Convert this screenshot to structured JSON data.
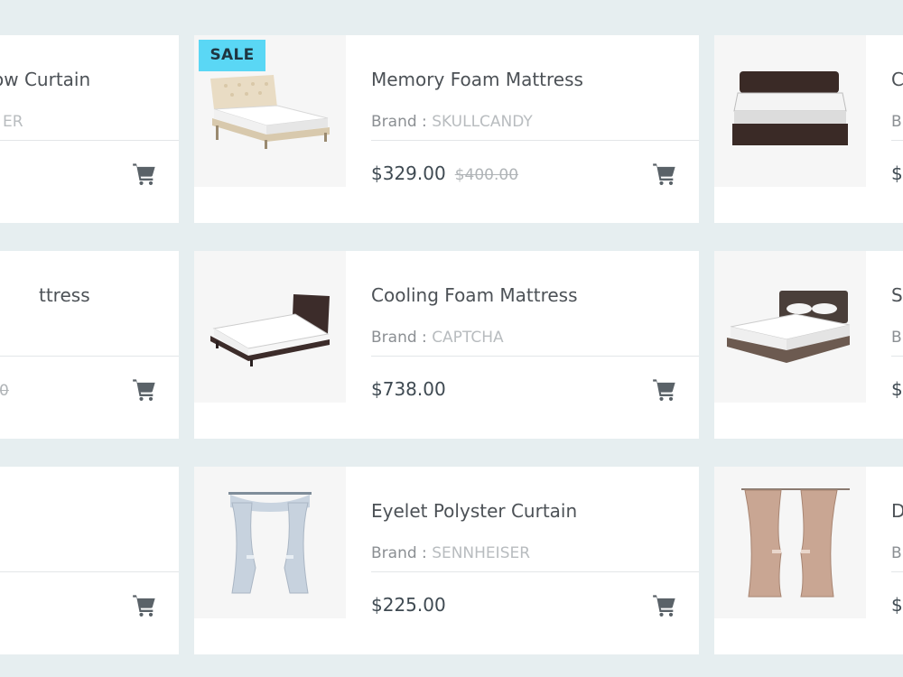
{
  "colors": {
    "background": "#e6eef0",
    "card": "#ffffff",
    "sale_badge": "#5ad7f5",
    "cart_icon": "#5a6268"
  },
  "rows": [
    {
      "left": {
        "title_fragment": "ow Curtain",
        "brand_fragment": "ER",
        "cart_icon": "cart-icon"
      },
      "center": {
        "badge": "SALE",
        "title": "Memory Foam Mattress",
        "brand_label": "Brand :",
        "brand": "SKULLCANDY",
        "price": "$329.00",
        "old_price": "$400.00",
        "image": "tufted-bed-image",
        "cart_icon": "cart-icon"
      },
      "right": {
        "title_fragment": "C",
        "brand_fragment": "B",
        "price_fragment": "$",
        "image": "pillowtop-mattress-image"
      }
    },
    {
      "left": {
        "title_fragment": "ttress",
        "price_fragment": "0",
        "cart_icon": "cart-icon"
      },
      "center": {
        "title": "Cooling Foam Mattress",
        "brand_label": "Brand :",
        "brand": "CAPTCHA",
        "price": "$738.00",
        "image": "platform-bed-image",
        "cart_icon": "cart-icon"
      },
      "right": {
        "title_fragment": "S",
        "brand_fragment": "B",
        "price_fragment": "$",
        "image": "upholstered-bed-image"
      }
    },
    {
      "left": {
        "cart_icon": "cart-icon"
      },
      "center": {
        "title": "Eyelet Polyster Curtain",
        "brand_label": "Brand :",
        "brand": "SENNHEISER",
        "price": "$225.00",
        "image": "blue-curtain-image",
        "cart_icon": "cart-icon"
      },
      "right": {
        "title_fragment": "D",
        "brand_fragment": "B",
        "price_fragment": "$",
        "image": "tan-curtain-image"
      }
    }
  ]
}
